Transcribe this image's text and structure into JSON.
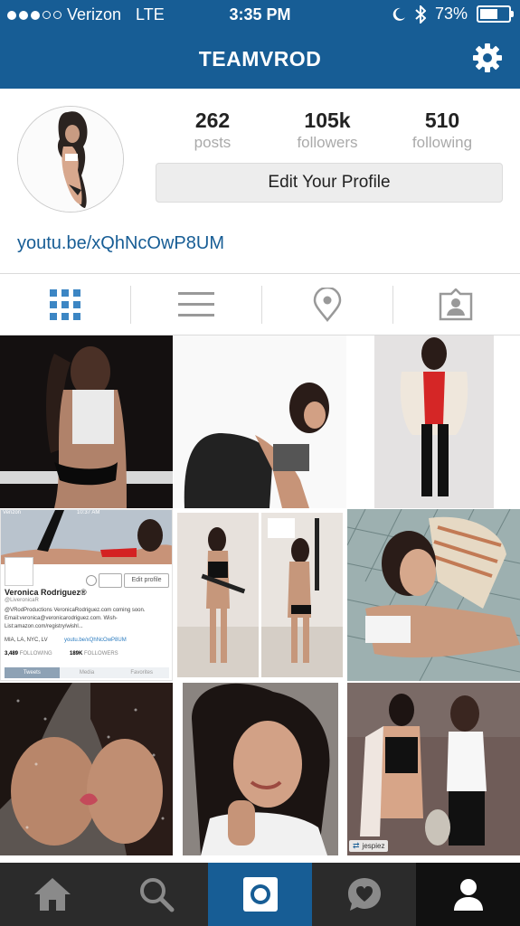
{
  "status_bar": {
    "carrier": "Verizon",
    "network": "LTE",
    "time": "3:35 PM",
    "battery": "73%",
    "battery_level": 0.73
  },
  "header": {
    "title": "TEAMVROD"
  },
  "profile": {
    "stats": [
      {
        "value": "262",
        "label": "posts"
      },
      {
        "value": "105k",
        "label": "followers"
      },
      {
        "value": "510",
        "label": "following"
      }
    ],
    "edit_button": "Edit Your Profile",
    "bio_link": "youtu.be/xQhNcOwP8UM"
  },
  "view_tabs": [
    "grid-view",
    "list-view",
    "location-view",
    "tagged-view"
  ],
  "embedded_screenshot": {
    "name": "Veronica Rodriguez®",
    "handle": "@LiveronicaR",
    "bio": "@VRodProductions VeronicaRodriguez.com coming soon. Email:veronica@veronicarodriguez.com. Wish-List:amazon.com/registry/wishl...",
    "location": "MIA, LA, NYC, LV",
    "link": "youtu.be/xQhNcOwP8UM",
    "following_count": "3,489",
    "following_label": "FOLLOWING",
    "followers_count": "189K",
    "followers_label": "FOLLOWERS",
    "edit_label": "Edit profile",
    "carrier": "Verizon",
    "time": "10:37 AM",
    "tabs": [
      "Tweets",
      "Media",
      "Favorites"
    ]
  },
  "repost_tag": "jespiez",
  "bottom_nav": [
    "home",
    "search",
    "camera",
    "activity",
    "profile"
  ],
  "colors": {
    "brand_blue": "#175d95",
    "link_blue": "#175d95",
    "bottom_bar": "#2b2b2b"
  }
}
